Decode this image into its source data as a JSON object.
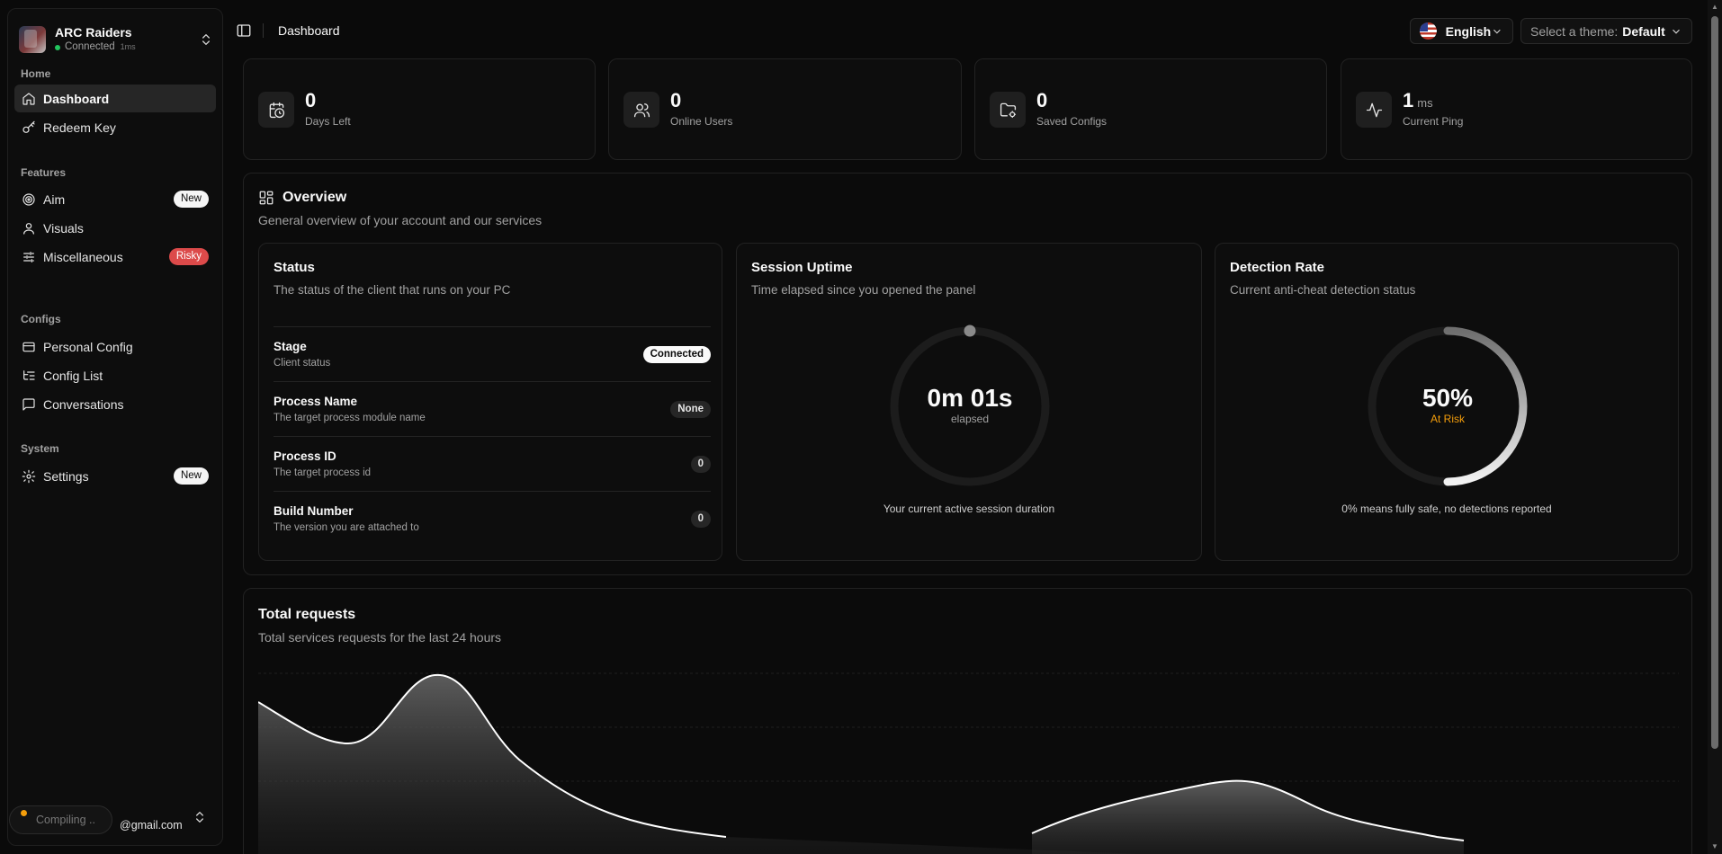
{
  "team": {
    "name": "ARC Raiders",
    "status": "Connected",
    "ping": "1ms"
  },
  "sidebar": {
    "groups": [
      {
        "label": "Home"
      },
      {
        "label": "Features"
      },
      {
        "label": "Configs"
      },
      {
        "label": "System"
      }
    ],
    "items": [
      {
        "label": "Dashboard",
        "icon": "home-icon",
        "active": true
      },
      {
        "label": "Redeem Key",
        "icon": "key-icon"
      },
      {
        "label": "Aim",
        "icon": "target-icon",
        "badge": "New"
      },
      {
        "label": "Visuals",
        "icon": "user-icon"
      },
      {
        "label": "Miscellaneous",
        "icon": "sliders-icon",
        "badge": "Risky"
      },
      {
        "label": "Personal Config",
        "icon": "credit-card-icon"
      },
      {
        "label": "Config List",
        "icon": "list-tree-icon"
      },
      {
        "label": "Conversations",
        "icon": "message-square-icon"
      },
      {
        "label": "Settings",
        "icon": "gear-icon",
        "badge": "New"
      }
    ],
    "footer": {
      "compiling": "Compiling ..",
      "email": "@gmail.com"
    }
  },
  "header": {
    "title": "Dashboard",
    "language": "English",
    "theme_label": "Select a theme:",
    "theme_value": "Default"
  },
  "stats": [
    {
      "value": "0",
      "unit": "",
      "label": "Days Left",
      "icon": "calendar-clock-icon"
    },
    {
      "value": "0",
      "unit": "",
      "label": "Online Users",
      "icon": "users-icon"
    },
    {
      "value": "0",
      "unit": "",
      "label": "Saved Configs",
      "icon": "folder-cog-icon"
    },
    {
      "value": "1",
      "unit": "ms",
      "label": "Current Ping",
      "icon": "activity-icon"
    }
  ],
  "overview": {
    "title": "Overview",
    "description": "General overview of your account and our services",
    "status_card": {
      "title": "Status",
      "description": "The status of the client that runs on your PC",
      "rows": [
        {
          "name": "Stage",
          "sub": "Client status",
          "value": "Connected"
        },
        {
          "name": "Process Name",
          "sub": "The target process module name",
          "value": "None"
        },
        {
          "name": "Process ID",
          "sub": "The target process id",
          "value": "0"
        },
        {
          "name": "Build Number",
          "sub": "The version you are attached to",
          "value": "0"
        }
      ]
    },
    "uptime_card": {
      "title": "Session Uptime",
      "description": "Time elapsed since you opened the panel",
      "value": "0m 01s",
      "unit": "elapsed",
      "footer": "Your current active session duration"
    },
    "detection_card": {
      "title": "Detection Rate",
      "description": "Current anti-cheat detection status",
      "value": "50%",
      "level": 0.5,
      "status": "At Risk",
      "status_color": "#f59e0b",
      "footer": "0% means fully safe, no detections reported"
    }
  },
  "requests": {
    "title": "Total requests",
    "description": "Total services requests for the last 24 hours"
  }
}
